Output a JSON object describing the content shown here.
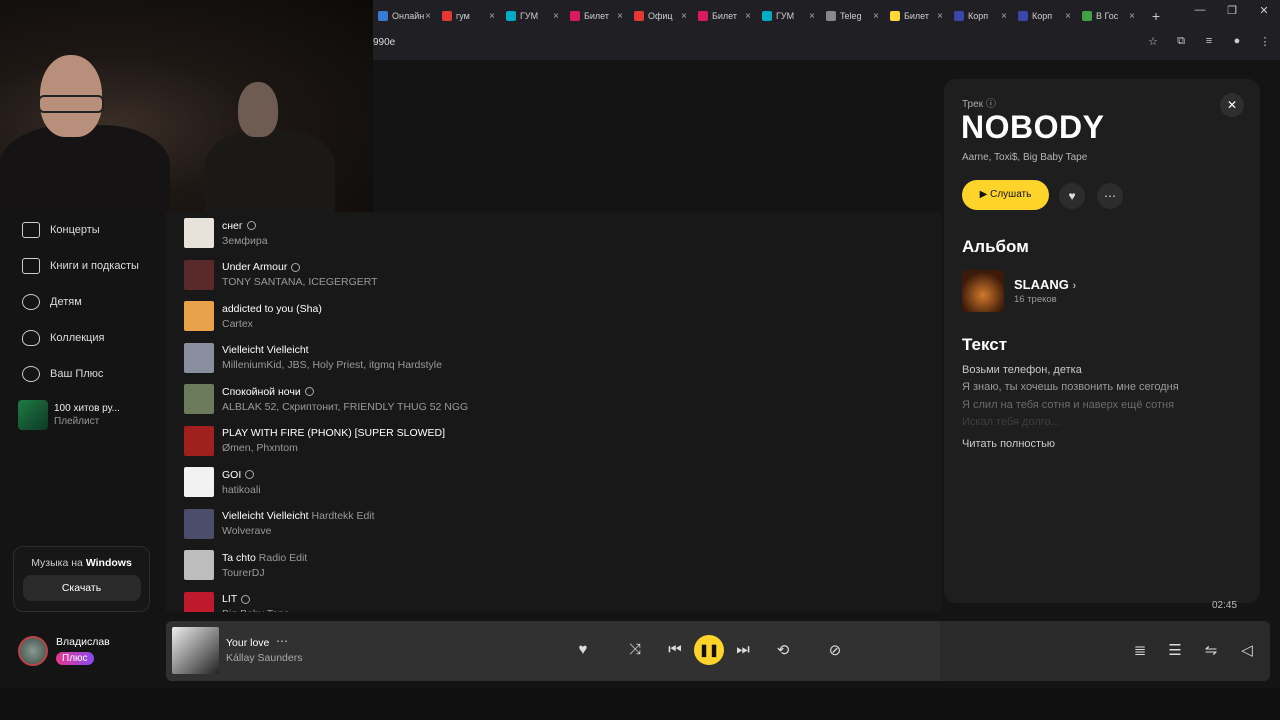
{
  "browser": {
    "tabs": [
      {
        "label": "Онлайн",
        "color": "#3a7bd5"
      },
      {
        "label": "гум",
        "color": "#e53935"
      },
      {
        "label": "ГУМ",
        "color": "#00acc1"
      },
      {
        "label": "Билет",
        "color": "#d81b60"
      },
      {
        "label": "Офиц",
        "color": "#e53935"
      },
      {
        "label": "Билет",
        "color": "#d81b60"
      },
      {
        "label": "ГУМ",
        "color": "#00acc1"
      },
      {
        "label": "Teleg",
        "color": "#888888"
      },
      {
        "label": "Билет",
        "color": "#fdd835"
      },
      {
        "label": "Корп",
        "color": "#3949ab"
      },
      {
        "label": "Корп",
        "color": "#3949ab"
      },
      {
        "label": "В Гос",
        "color": "#43a047"
      }
    ],
    "url": "990e"
  },
  "sidebar": {
    "items": [
      {
        "label": "Концерты"
      },
      {
        "label": "Книги и подкасты"
      },
      {
        "label": "Детям"
      },
      {
        "label": "Коллекция"
      },
      {
        "label": "Ваш Плюс"
      }
    ],
    "playlist": {
      "title": "100 хитов ру...",
      "subtitle": "Плейлист"
    },
    "windows_promo": {
      "text": "Музыка на ",
      "brand": "Windows",
      "button": "Скачать"
    },
    "user": {
      "name": "Владислав",
      "badge": "Плюс"
    }
  },
  "tracks": [
    {
      "title": "снег",
      "version": "",
      "artist": "Земфира",
      "info": true,
      "cover": "#e8e3da"
    },
    {
      "title": "Under Armour",
      "version": "",
      "artist": "TONY SANTANA, ICEGERGERT",
      "info": true,
      "cover": "#5a2a2a"
    },
    {
      "title": "addicted to you (Sha)",
      "version": "",
      "artist": "Cartex",
      "info": false,
      "cover": "#e8a24a"
    },
    {
      "title": "Vielleicht Vielleicht",
      "version": "",
      "artist": "MilleniumKid, JBS, Holy Priest, itgmq Hardstyle",
      "info": false,
      "cover": "#8a8fa0"
    },
    {
      "title": "Спокойной ночи",
      "version": "",
      "artist": "ALBLAK 52, Скриптонит, FRIENDLY THUG 52 NGG",
      "info": true,
      "cover": "#6a7a5a"
    },
    {
      "title": "PLAY WITH FIRE (PHONK) [SUPER SLOWED]",
      "version": "",
      "artist": "Ømen, Phxntom",
      "info": false,
      "cover": "#a02020"
    },
    {
      "title": "GOI",
      "version": "",
      "artist": "hatikoali",
      "info": true,
      "cover": "#f2f2f2"
    },
    {
      "title": "Vielleicht Vielleicht",
      "version": "Hardtekk Edit",
      "artist": "Wolverave",
      "info": false,
      "cover": "#4a4e6a"
    },
    {
      "title": "Ta chto",
      "version": "Radio Edit",
      "artist": "TourerDJ",
      "info": false,
      "cover": "#bdbdbd"
    },
    {
      "title": "LIT",
      "version": "",
      "artist": "Big Baby Tape",
      "info": true,
      "cover": "#c0182c"
    }
  ],
  "panel": {
    "kind": "Трек",
    "title": "NOBODY",
    "artists": "Aarne, Toxi$, Big Baby Tape",
    "listen": "Слушать",
    "album_heading": "Альбом",
    "album": {
      "title": "SLAANG",
      "tracks": "16 треков"
    },
    "lyrics_heading": "Текст",
    "lyrics": [
      "Возьми телефон, детка",
      "Я знаю, ты хочешь позвонить мне сегодня",
      "Я слил на тебя сотня и наверх ещё сотня",
      "Искал тебя долго..."
    ],
    "read_more": "Читать полностью"
  },
  "time": "02:45",
  "player": {
    "title": "Your love",
    "artist": "Kállay Saunders"
  }
}
